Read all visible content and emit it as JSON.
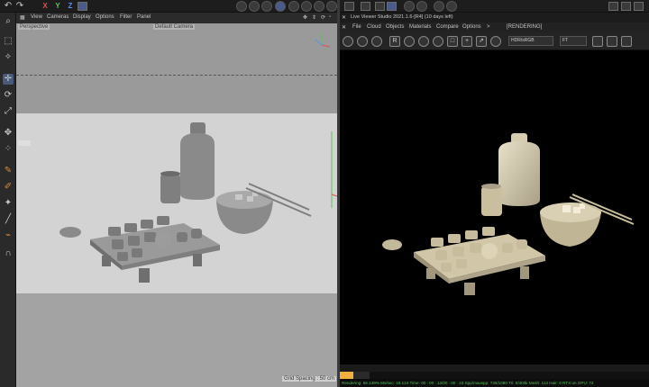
{
  "topbar": {
    "axis_x": "X",
    "axis_y": "Y",
    "axis_z": "Z"
  },
  "viewport": {
    "menu": [
      "View",
      "Cameras",
      "Display",
      "Options",
      "Filter",
      "Panel"
    ],
    "camera_mode": "Perspective",
    "camera_name": "Default Camera",
    "grid_spacing": "Grid Spacing : 50 cm"
  },
  "live_viewer": {
    "title": "Live Viewer Studio 2021.1.6-[R4] (10 days left)",
    "menu": [
      "File",
      "Cloud",
      "Objects",
      "Materials",
      "Compare",
      "Options",
      ">"
    ],
    "state": "[RENDERING]",
    "color_space": "HDR/sRGB",
    "tone": "FT",
    "progress": 0.045,
    "stats": "Rendering: 56.149%  Ms/sec: 18.124  Time: 00 : 00 : 13/00 : 00 : 23  Spp/maxspp: 736/1080  Tri: 0/400k  Mesh: 113  Hair: 0  RTX:on  GPU: 72"
  },
  "colors": {
    "axis_x": "#e05252",
    "axis_y": "#5fc35f",
    "axis_z": "#5a8ef0",
    "accent": "#f0b040",
    "status_text": "#57c25a"
  }
}
